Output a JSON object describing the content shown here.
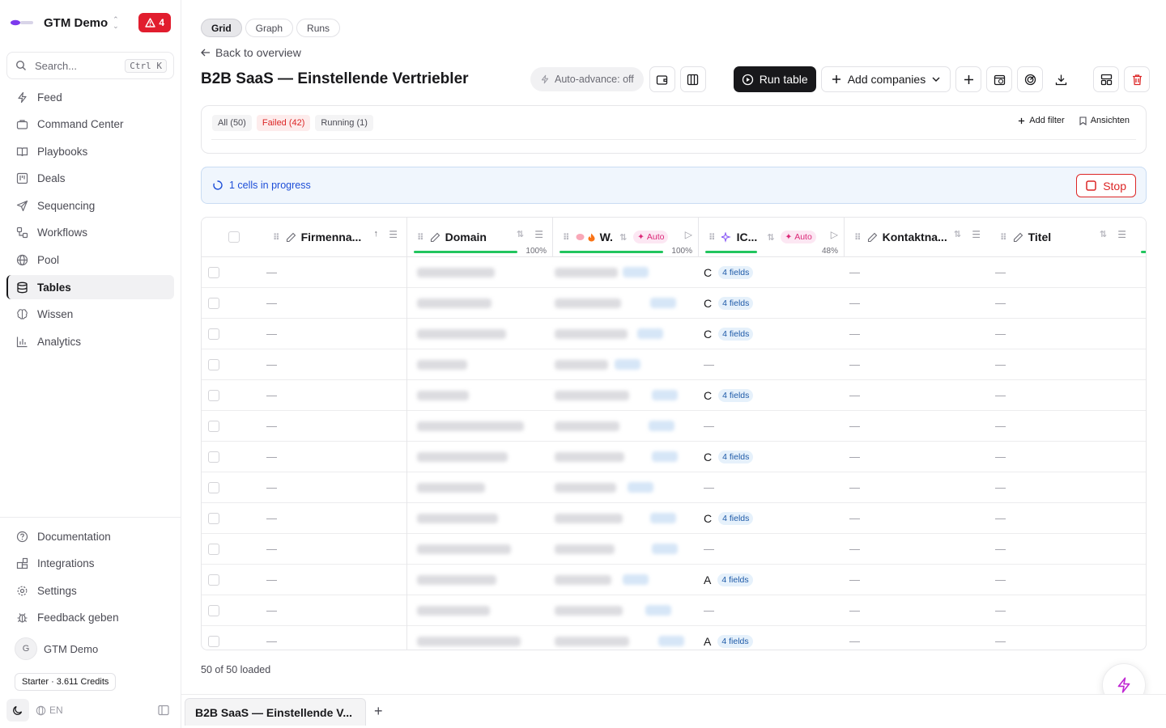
{
  "sidebar": {
    "workspace": "GTM Demo",
    "alert_count": "4",
    "search_placeholder": "Search...",
    "search_shortcut": "Ctrl K",
    "items": [
      {
        "label": "Feed",
        "icon": "zap-icon"
      },
      {
        "label": "Command Center",
        "icon": "briefcase-icon"
      },
      {
        "label": "Playbooks",
        "icon": "book-icon"
      },
      {
        "label": "Deals",
        "icon": "kanban-icon"
      },
      {
        "label": "Sequencing",
        "icon": "send-icon"
      },
      {
        "label": "Workflows",
        "icon": "workflow-icon"
      },
      {
        "label": "Pool",
        "icon": "globe-icon"
      },
      {
        "label": "Tables",
        "icon": "database-icon",
        "active": true
      },
      {
        "label": "Wissen",
        "icon": "brain-icon"
      },
      {
        "label": "Analytics",
        "icon": "bar-chart-icon"
      }
    ],
    "bottom_items": [
      {
        "label": "Documentation",
        "icon": "help-circle-icon"
      },
      {
        "label": "Integrations",
        "icon": "blocks-icon"
      },
      {
        "label": "Settings",
        "icon": "gear-icon"
      },
      {
        "label": "Feedback geben",
        "icon": "bug-icon"
      }
    ],
    "user_initial": "G",
    "user_name": "GTM Demo",
    "plan": "Starter · 3.611 Credits",
    "language": "EN"
  },
  "main": {
    "view_tabs": [
      "Grid",
      "Graph",
      "Runs"
    ],
    "active_view": "Grid",
    "back_link": "Back to overview",
    "title": "B2B SaaS — Einstellende Vertriebler",
    "auto_advance": "Auto-advance: off",
    "run_table": "Run table",
    "add_companies": "Add companies",
    "filters": {
      "all": "All (50)",
      "failed": "Failed (42)",
      "running": "Running (1)",
      "add_filter": "Add filter",
      "views": "Ansichten"
    },
    "progress_text": "1 cells in progress",
    "stop_label": "Stop",
    "loaded_text": "50 of 50 loaded",
    "bottom_tab": "B2B SaaS — Einstellende V...",
    "colors": {
      "accent": "#18181b",
      "danger": "#dc2626",
      "info": "#1d4ed8",
      "progress": "#22c55e",
      "auto": "#db2777"
    }
  },
  "table": {
    "columns": [
      {
        "label": "Firmenna...",
        "progress": null
      },
      {
        "label": "Domain",
        "progress": "100%",
        "progress_value": 1.0
      },
      {
        "label": "W.",
        "badge": "Auto",
        "progress": "100%",
        "progress_value": 1.0
      },
      {
        "label": "IC...",
        "badge": "Auto",
        "progress": "48%",
        "progress_value": 0.48
      },
      {
        "label": "Kontaktna...",
        "progress": null
      },
      {
        "label": "Titel",
        "progress": null
      }
    ],
    "empty_cell": "—",
    "fields_label": "4 fields",
    "rows": [
      {
        "score": "C",
        "fields": true
      },
      {
        "score": "C",
        "fields": true
      },
      {
        "score": "C",
        "fields": true
      },
      {
        "score": "—",
        "fields": false
      },
      {
        "score": "C",
        "fields": true
      },
      {
        "score": "—",
        "fields": false
      },
      {
        "score": "C",
        "fields": true
      },
      {
        "score": "—",
        "fields": false
      },
      {
        "score": "C",
        "fields": true
      },
      {
        "score": "—",
        "fields": false
      },
      {
        "score": "A",
        "fields": true
      },
      {
        "score": "—",
        "fields": false
      },
      {
        "score": "A",
        "fields": true
      }
    ]
  }
}
